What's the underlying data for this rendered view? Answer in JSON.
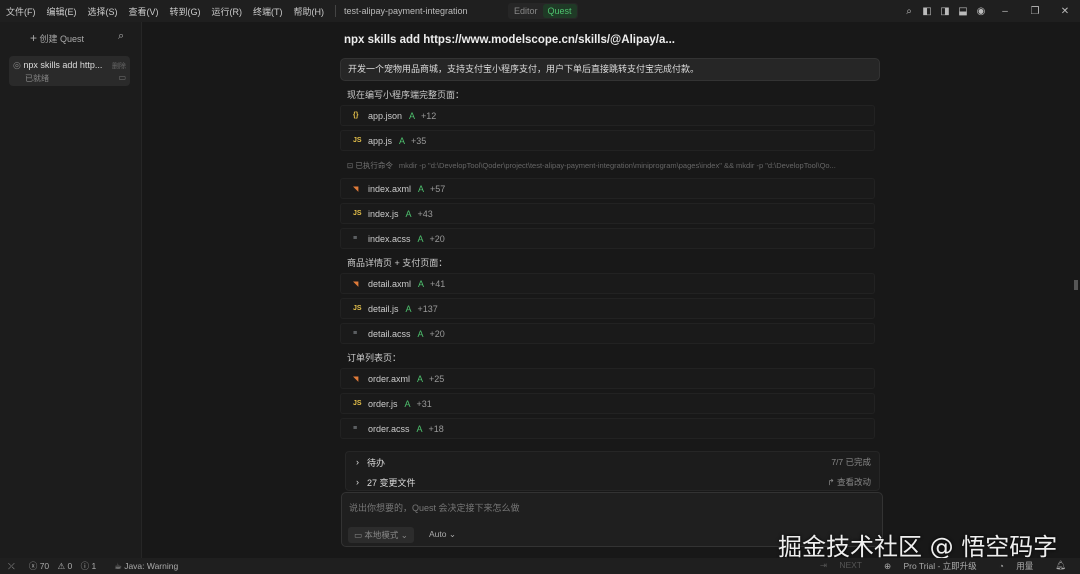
{
  "titlebar": {
    "menus": [
      "文件(F)",
      "编辑(E)",
      "选择(S)",
      "查看(V)",
      "转到(G)",
      "运行(R)",
      "终端(T)",
      "帮助(H)"
    ],
    "project": "test-alipay-payment-integration",
    "modes": [
      "Editor",
      "Quest"
    ]
  },
  "sidebar": {
    "new_quest": "创建 Quest",
    "quest": {
      "title": "npx skills add http...",
      "status": "已就绪",
      "delete": "删除"
    }
  },
  "main": {
    "title": "npx skills add https://www.modelscope.cn/skills/@Alipay/a...",
    "prompt": "开发一个宠物用品商城，支持支付宝小程序支付，用户下单后直接跳转支付宝完成付款。",
    "sections": [
      {
        "label": "现在编写小程序端完整页面：",
        "items": [
          {
            "type": "row",
            "icon": "{}",
            "kind": "json",
            "name": "app.json",
            "flag": "A",
            "add": "+12"
          },
          {
            "type": "row",
            "icon": "JS",
            "kind": "js",
            "name": "app.js",
            "flag": "A",
            "add": "+35"
          },
          {
            "type": "cmd",
            "label": "已执行命令",
            "cmd": "mkdir -p \"d:\\DevelopTool\\Qoder\\project\\test-alipay-payment-integration\\miniprogram\\pages\\index\" && mkdir -p \"d:\\DevelopTool\\Qo..."
          },
          {
            "type": "row",
            "icon": "◥",
            "kind": "axml",
            "name": "index.axml",
            "flag": "A",
            "add": "+57"
          },
          {
            "type": "row",
            "icon": "JS",
            "kind": "js",
            "name": "index.js",
            "flag": "A",
            "add": "+43"
          },
          {
            "type": "row",
            "icon": "≡",
            "kind": "acss",
            "name": "index.acss",
            "flag": "A",
            "add": "+20"
          }
        ]
      },
      {
        "label": "商品详情页 + 支付页面：",
        "items": [
          {
            "type": "row",
            "icon": "◥",
            "kind": "axml",
            "name": "detail.axml",
            "flag": "A",
            "add": "+41"
          },
          {
            "type": "row",
            "icon": "JS",
            "kind": "js",
            "name": "detail.js",
            "flag": "A",
            "add": "+137"
          },
          {
            "type": "row",
            "icon": "≡",
            "kind": "acss",
            "name": "detail.acss",
            "flag": "A",
            "add": "+20"
          }
        ]
      },
      {
        "label": "订单列表页：",
        "items": [
          {
            "type": "row",
            "icon": "◥",
            "kind": "axml",
            "name": "order.axml",
            "flag": "A",
            "add": "+25"
          },
          {
            "type": "row",
            "icon": "JS",
            "kind": "js",
            "name": "order.js",
            "flag": "A",
            "add": "+31"
          },
          {
            "type": "row",
            "icon": "≡",
            "kind": "acss",
            "name": "order.acss",
            "flag": "A",
            "add": "+18"
          }
        ]
      }
    ]
  },
  "summary": {
    "todo": "待办",
    "todo_status": "7/7 已完成",
    "changed": "27 变更文件",
    "view_changes": "查看改动"
  },
  "input": {
    "placeholder": "说出你想要的，Quest 会决定接下来怎么做",
    "mode": "本地模式",
    "model": "Auto"
  },
  "watermark": "掘金技术社区 @ 悟空码字",
  "status": {
    "errors": "70",
    "warnings": "0",
    "infos": "1",
    "java": "Java: Warning",
    "next": "NEXT",
    "trial": "Pro Trial - 立即升级",
    "usage": "用量"
  },
  "colors": {
    "accent": "#4ec26e",
    "json": "#e5c04a",
    "js": "#e5c04a",
    "axml": "#e07b39",
    "acss": "#9aa0a6"
  }
}
